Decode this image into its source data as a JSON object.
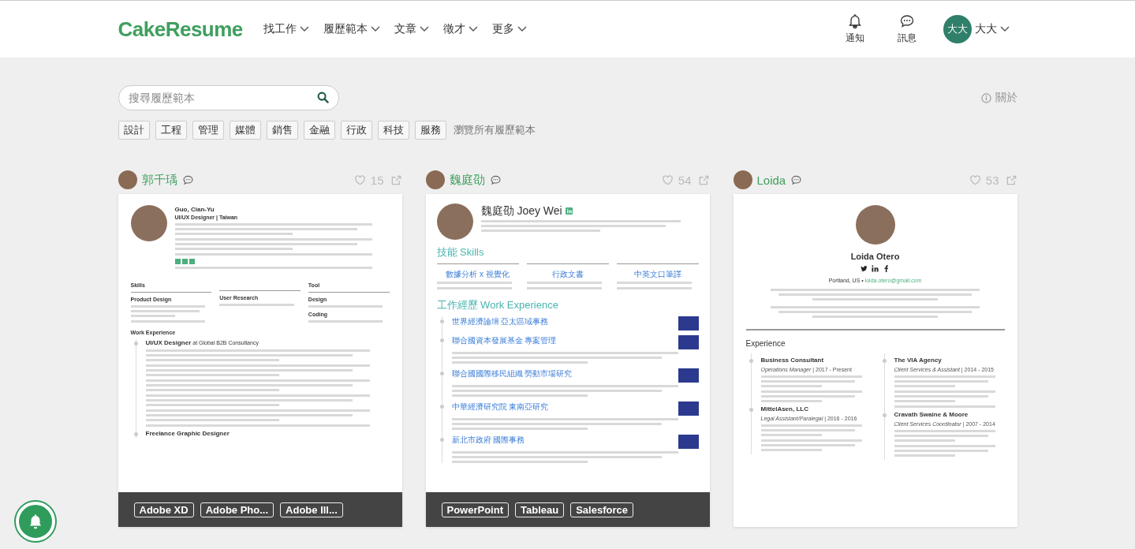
{
  "header": {
    "logo": "CakeResume",
    "nav": [
      {
        "label": "找工作"
      },
      {
        "label": "履歷範本"
      },
      {
        "label": "文章"
      },
      {
        "label": "徵才"
      },
      {
        "label": "更多"
      }
    ],
    "notifications": "通知",
    "messages": "訊息",
    "user": {
      "avatar": "大大",
      "name": "大大"
    }
  },
  "search": {
    "placeholder": "搜尋履歷範本"
  },
  "about": "關於",
  "categories": [
    "設計",
    "工程",
    "管理",
    "媒體",
    "銷售",
    "金融",
    "行政",
    "科技",
    "服務"
  ],
  "browse_all": "瀏覽所有履歷範本",
  "templates": [
    {
      "author": "郭千瑀",
      "likes": "15",
      "tags": [
        "Adobe XD",
        "Adobe Pho...",
        "Adobe Ill..."
      ],
      "resume": {
        "cjk": false,
        "blocks": [
          {
            "kind": "row",
            "children": [
              {
                "kind": "photo"
              },
              {
                "kind": "col",
                "children": [
                  {
                    "kind": "name",
                    "text": "Guo, Cian-Yu",
                    "badge": false
                  },
                  {
                    "kind": "subtitle",
                    "text": "UI/UX Designer | Taiwan"
                  },
                  {
                    "kind": "paragraph"
                  },
                  {
                    "kind": "paragraph"
                  },
                  {
                    "kind": "blur"
                  },
                  {
                    "kind": "badges"
                  },
                  {
                    "kind": "blur"
                  }
                ]
              }
            ]
          },
          {
            "kind": "row",
            "children": [
              {
                "kind": "col",
                "children": [
                  {
                    "kind": "section",
                    "text": "Skills"
                  },
                  {
                    "kind": "label",
                    "text": "Product Design"
                  },
                  {
                    "kind": "paragraph"
                  },
                  {
                    "kind": "blur"
                  }
                ]
              },
              {
                "kind": "col",
                "children": [
                  {
                    "kind": "rule"
                  },
                  {
                    "kind": "label",
                    "text": "User Research"
                  },
                  {
                    "kind": "blur"
                  }
                ]
              },
              {
                "kind": "col",
                "children": [
                  {
                    "kind": "section",
                    "text": "Tool"
                  },
                  {
                    "kind": "label",
                    "text": "Design"
                  },
                  {
                    "kind": "blur"
                  },
                  {
                    "kind": "label",
                    "text": "Coding"
                  },
                  {
                    "kind": "blur"
                  }
                ]
              }
            ]
          },
          {
            "kind": "label",
            "text": "Work Experience"
          },
          {
            "kind": "timeline",
            "children": [
              {
                "kind": "job",
                "text": "UI/UX Designer",
                "org": "at Global B2B Consultancy",
                "logo": false
              },
              {
                "kind": "paragraph"
              },
              {
                "kind": "paragraph"
              },
              {
                "kind": "paragraph"
              },
              {
                "kind": "paragraph"
              },
              {
                "kind": "paragraph"
              },
              {
                "kind": "blur"
              },
              {
                "kind": "job",
                "text": "Freelance Graphic Designer",
                "logo": false
              }
            ]
          }
        ]
      }
    },
    {
      "author": "魏庭劭",
      "likes": "54",
      "tags": [
        "PowerPoint",
        "Tableau",
        "Salesforce"
      ],
      "resume": {
        "cjk": true,
        "blocks": [
          {
            "kind": "row",
            "children": [
              {
                "kind": "photo"
              },
              {
                "kind": "col",
                "children": [
                  {
                    "kind": "name",
                    "text": "魏庭劭 Joey Wei",
                    "badge": true
                  },
                  {
                    "kind": "paragraph"
                  }
                ]
              }
            ]
          },
          {
            "kind": "section",
            "text": "技能 Skills"
          },
          {
            "kind": "row",
            "children": [
              {
                "kind": "col",
                "children": [
                  {
                    "kind": "skillhead",
                    "text": "數據分析 x 視覺化"
                  },
                  {
                    "kind": "blur"
                  },
                  {
                    "kind": "blur"
                  }
                ]
              },
              {
                "kind": "col",
                "children": [
                  {
                    "kind": "skillhead",
                    "text": "行政文書"
                  },
                  {
                    "kind": "blur"
                  },
                  {
                    "kind": "blur"
                  }
                ]
              },
              {
                "kind": "col",
                "children": [
                  {
                    "kind": "skillhead",
                    "text": "中英文口筆譯"
                  },
                  {
                    "kind": "blur"
                  },
                  {
                    "kind": "blur"
                  }
                ]
              }
            ]
          },
          {
            "kind": "section",
            "text": "工作經歷 Work Experience"
          },
          {
            "kind": "timeline",
            "children": [
              {
                "kind": "job",
                "text": "世界經濟論壇 亞太區域事務",
                "logo": true
              },
              {
                "kind": "job",
                "text": "聯合國資本發展基金 專案管理",
                "logo": true
              },
              {
                "kind": "paragraph"
              },
              {
                "kind": "job",
                "text": "聯合國國際移民組織 勞動市場研究",
                "logo": true
              },
              {
                "kind": "paragraph"
              },
              {
                "kind": "job",
                "text": "中華經濟研究院 東南亞研究",
                "logo": true
              },
              {
                "kind": "paragraph"
              },
              {
                "kind": "job",
                "text": "新北市政府 國際事務",
                "logo": true
              },
              {
                "kind": "paragraph"
              }
            ]
          }
        ]
      }
    },
    {
      "author": "Loida",
      "likes": "53",
      "resume": {
        "cjk": false,
        "blocks": [
          {
            "kind": "center",
            "children": [
              {
                "kind": "photo"
              },
              {
                "kind": "name",
                "text": "Loida Otero",
                "badge": false
              },
              {
                "kind": "social"
              },
              {
                "kind": "runs",
                "runs": [
                  {
                    "text": "Portland, US • ",
                    "link": false
                  },
                  {
                    "text": "loida.otero@gmail.com",
                    "link": true
                  }
                ]
              },
              {
                "kind": "paragraph"
              },
              {
                "kind": "paragraph"
              }
            ]
          },
          {
            "kind": "rule"
          },
          {
            "kind": "heading",
            "text": "Experience"
          },
          {
            "kind": "row",
            "children": [
              {
                "kind": "timeline",
                "children": [
                  {
                    "kind": "job",
                    "text": "Business Consultant",
                    "logo": false
                  },
                  {
                    "kind": "meta",
                    "text": "*Operations Manager* | 2017 - Present"
                  },
                  {
                    "kind": "paragraph"
                  },
                  {
                    "kind": "paragraph"
                  },
                  {
                    "kind": "job",
                    "text": "MittelAsen, LLC",
                    "logo": false
                  },
                  {
                    "kind": "meta",
                    "text": "*Legal Assistant/Paralegal* | 2016 - 2016"
                  },
                  {
                    "kind": "paragraph"
                  },
                  {
                    "kind": "paragraph"
                  }
                ]
              },
              {
                "kind": "timeline",
                "children": [
                  {
                    "kind": "job",
                    "text": "The VIA Agency",
                    "logo": false
                  },
                  {
                    "kind": "meta",
                    "text": "*Client Services & Assistant* | 2014 - 2015"
                  },
                  {
                    "kind": "paragraph"
                  },
                  {
                    "kind": "paragraph"
                  },
                  {
                    "kind": "blur"
                  },
                  {
                    "kind": "job",
                    "text": "Cravath Swaine & Moore",
                    "logo": false
                  },
                  {
                    "kind": "meta",
                    "text": "*Client Services Coordinator* | 2007 - 2014"
                  },
                  {
                    "kind": "paragraph"
                  },
                  {
                    "kind": "paragraph"
                  }
                ]
              }
            ]
          }
        ]
      }
    }
  ]
}
